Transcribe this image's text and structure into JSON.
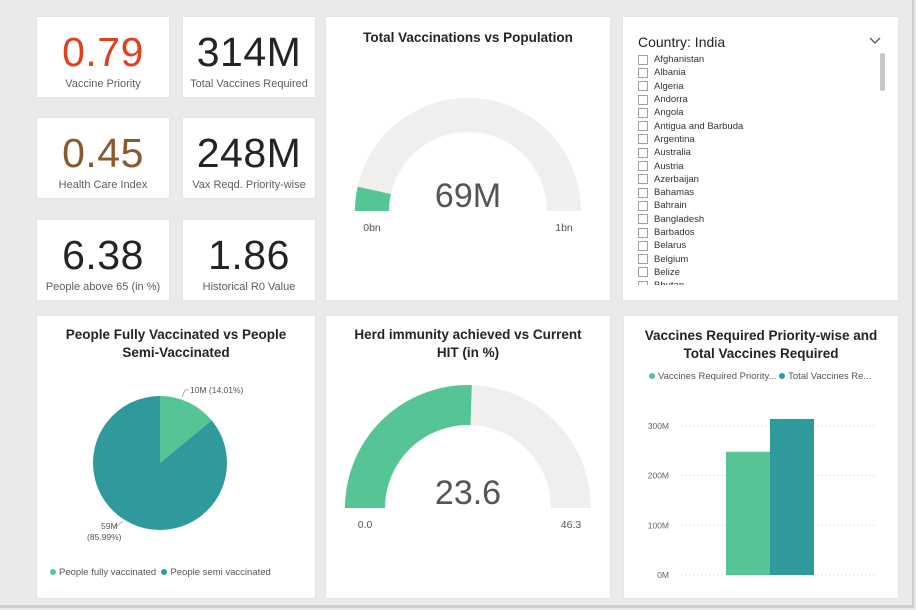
{
  "kpis": [
    {
      "value": "0.79",
      "label": "Vaccine Priority",
      "color": "#e0401e"
    },
    {
      "value": "314M",
      "label": "Total Vaccines Required",
      "color": "#252423"
    },
    {
      "value": "0.45",
      "label": "Health Care Index",
      "color": "#8a5a2b"
    },
    {
      "value": "248M",
      "label": "Vax Reqd. Priority-wise",
      "color": "#252423"
    },
    {
      "value": "6.38",
      "label": "People above 65 (in %)",
      "color": "#252423"
    },
    {
      "value": "1.86",
      "label": "Historical R0 Value",
      "color": "#252423"
    }
  ],
  "slicer": {
    "title": "Country: India",
    "items": [
      "Afghanistan",
      "Albania",
      "Algeria",
      "Andorra",
      "Angola",
      "Antigua and Barbuda",
      "Argentina",
      "Australia",
      "Austria",
      "Azerbaijan",
      "Bahamas",
      "Bahrain",
      "Bangladesh",
      "Barbados",
      "Belarus",
      "Belgium",
      "Belize",
      "Bhutan"
    ],
    "icon": "chevron-down-icon"
  },
  "colors": {
    "green": "#55c595",
    "teal": "#30999b",
    "track": "#f0efee"
  },
  "chart_data": [
    {
      "type": "gauge",
      "title": "Total Vaccinations vs Population",
      "value": 0.069,
      "value_label": "69M",
      "min": 0,
      "max": 1,
      "min_label": "0bn",
      "max_label": "1bn"
    },
    {
      "type": "pie",
      "title": "People Fully Vaccinated vs People Semi-Vaccinated",
      "slices": [
        {
          "name": "People fully vaccinated",
          "value": 10,
          "value_label": "10M (14.01%)",
          "percent": 14.01
        },
        {
          "name": "People semi vaccinated",
          "value": 59,
          "value_label": "59M",
          "percent_label": "(85.99%)",
          "percent": 85.99
        }
      ]
    },
    {
      "type": "gauge",
      "title": "Herd immunity achieved vs Current HIT (in %)",
      "value": 23.6,
      "value_label": "23.6",
      "min": 0,
      "max": 46.3,
      "min_label": "0.0",
      "max_label": "46.3"
    },
    {
      "type": "bar",
      "title": "Vaccines Required Priority-wise and Total Vaccines Required",
      "legend": [
        "Vaccines Required Priority...",
        "Total Vaccines Re..."
      ],
      "series": [
        {
          "name": "Vaccines Required Priority-wise",
          "values": [
            248
          ]
        },
        {
          "name": "Total Vaccines Required",
          "values": [
            314
          ]
        }
      ],
      "ylim": [
        0,
        330
      ],
      "yticks": [
        0,
        100,
        200,
        300
      ],
      "ytick_labels": [
        "0M",
        "100M",
        "200M",
        "300M"
      ]
    }
  ]
}
